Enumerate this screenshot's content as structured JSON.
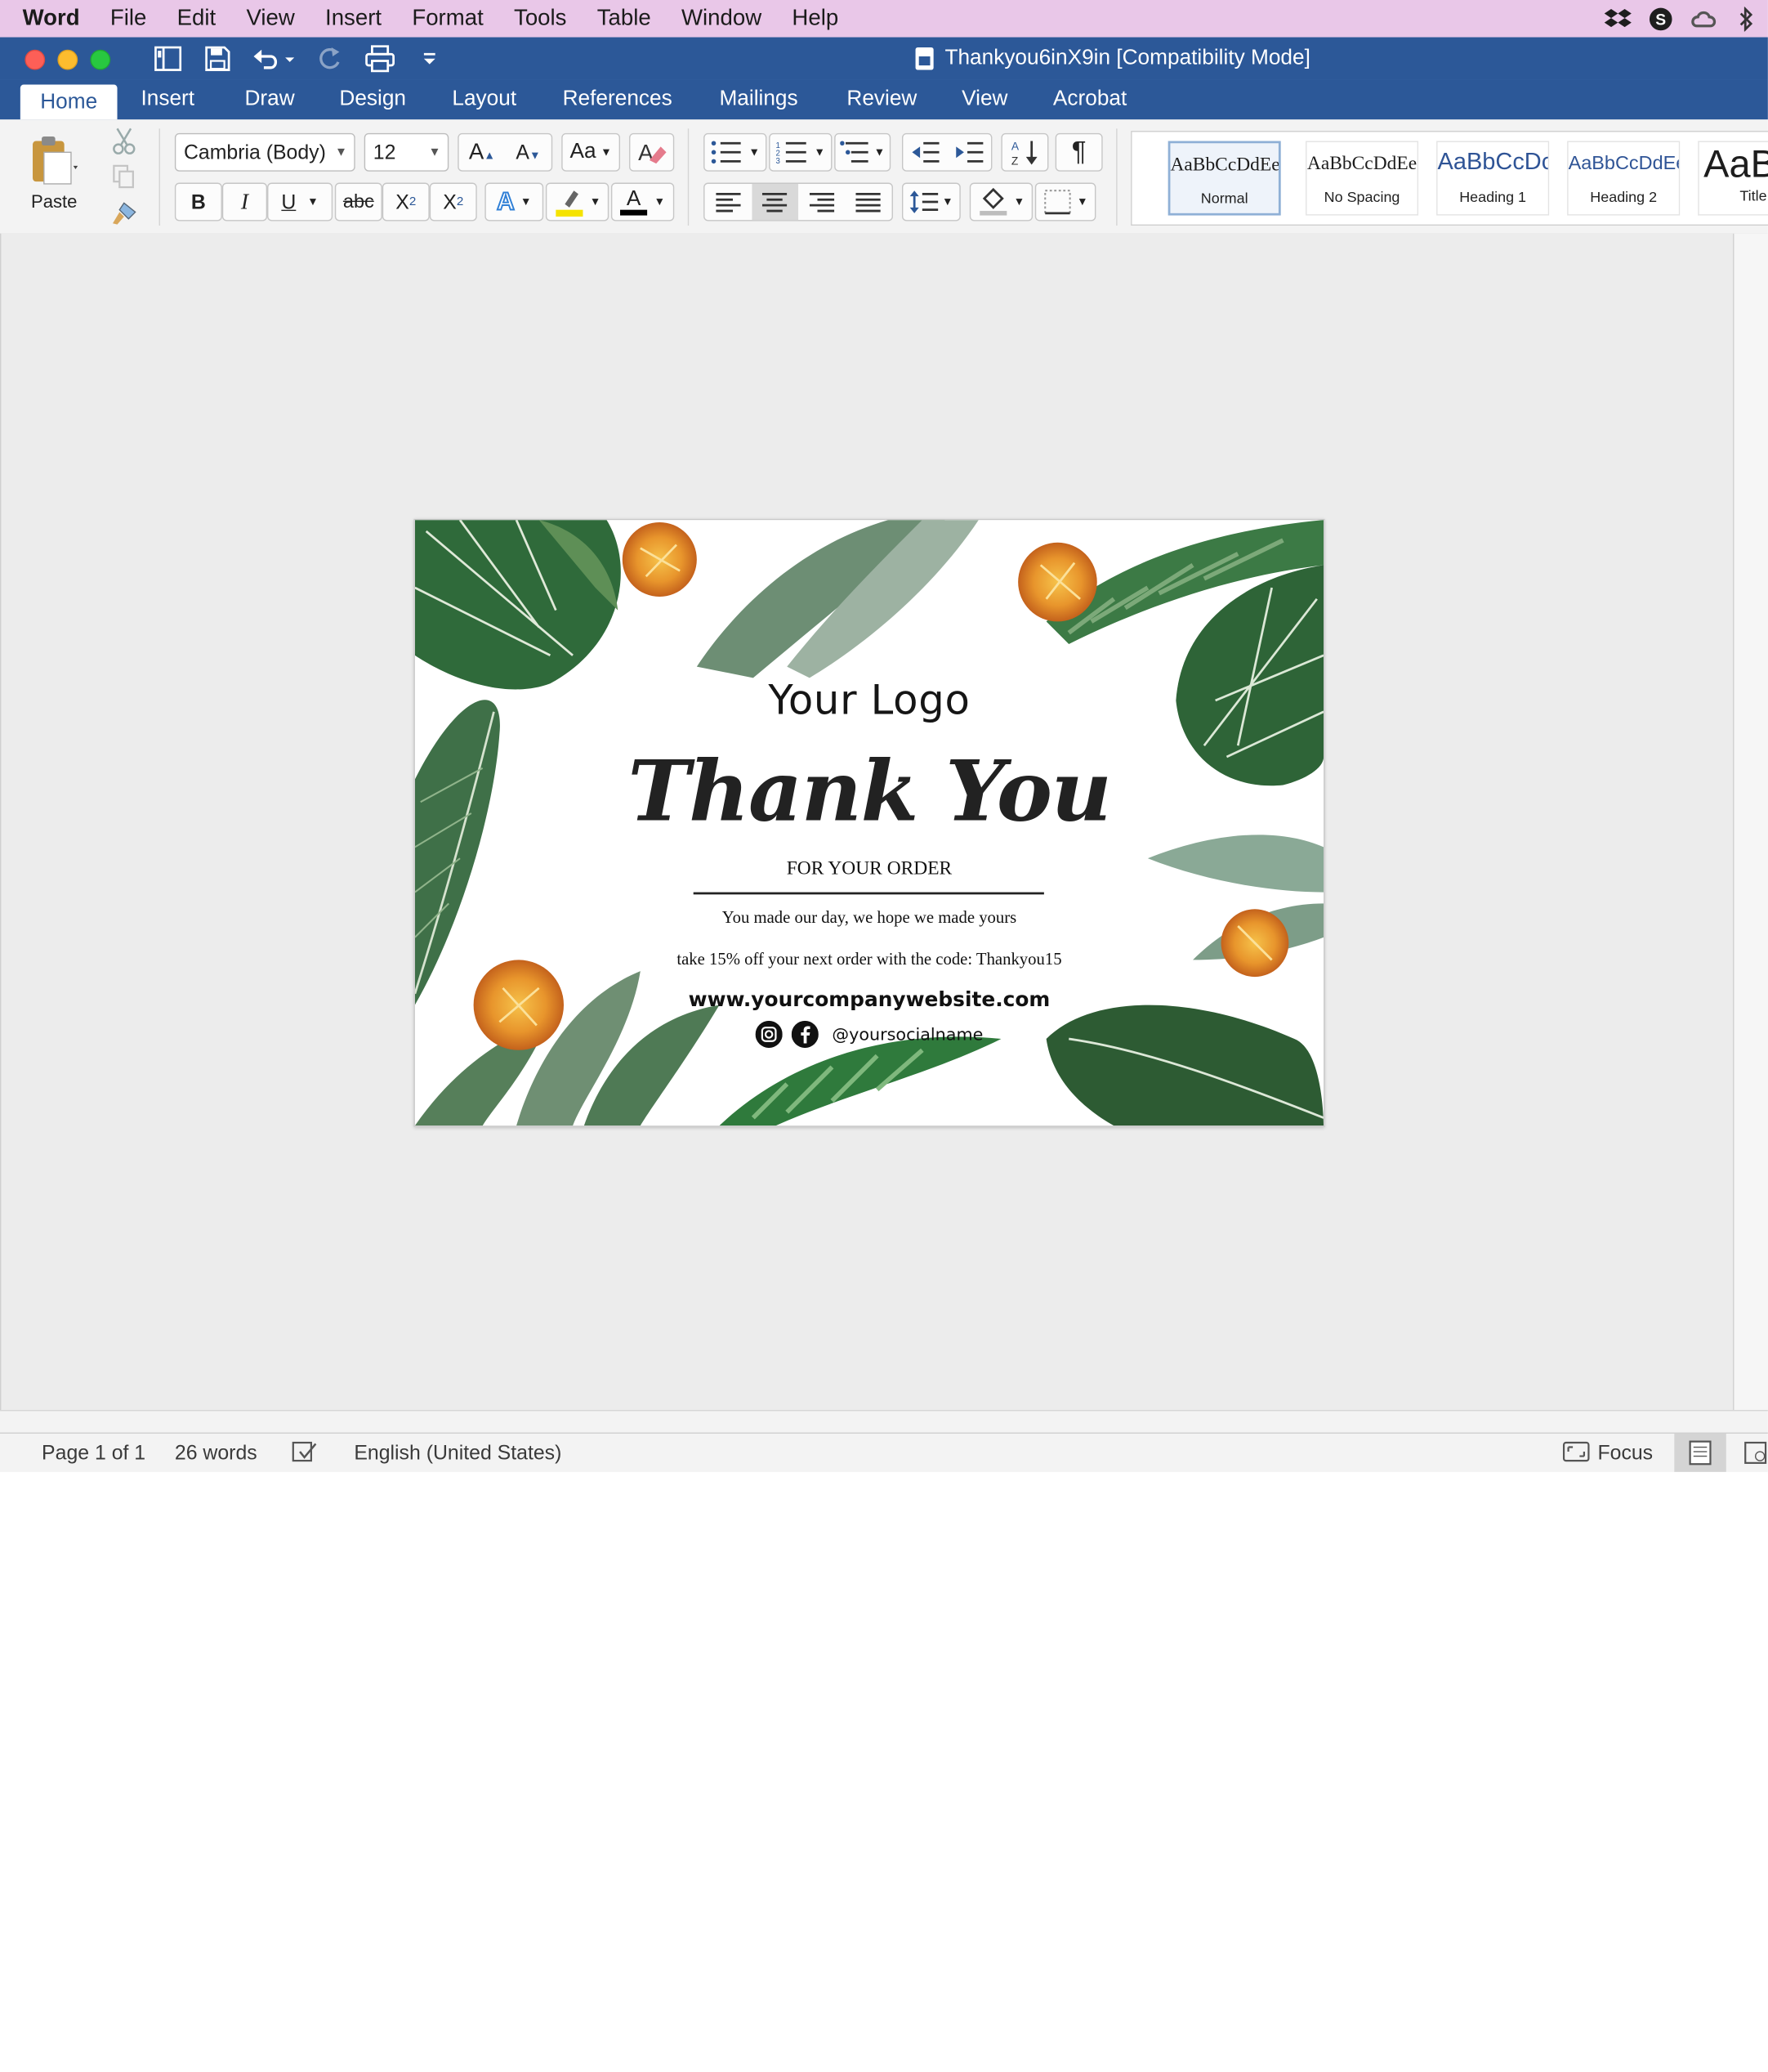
{
  "menubar": {
    "app": "Word",
    "items": [
      "File",
      "Edit",
      "View",
      "Insert",
      "Format",
      "Tools",
      "Table",
      "Window",
      "Help"
    ],
    "tray_icons": [
      "dropbox-icon",
      "skype-icon",
      "creative-cloud-icon",
      "bluetooth-icon"
    ]
  },
  "window": {
    "title": "Thankyou6inX9in [Compatibility Mode]"
  },
  "tabs": [
    "Home",
    "Insert",
    "Draw",
    "Design",
    "Layout",
    "References",
    "Mailings",
    "Review",
    "View",
    "Acrobat"
  ],
  "ribbon": {
    "paste_label": "Paste",
    "font_name": "Cambria (Body)",
    "font_size": "12",
    "grow_font": "A",
    "shrink_font": "A",
    "change_case": "Aa",
    "bold": "B",
    "italic": "I",
    "underline": "U",
    "strikethrough": "abc",
    "subscript": "X",
    "subscript_mark": "2",
    "superscript": "X",
    "superscript_mark": "2",
    "text_effects": "A",
    "font_color": "A",
    "pilcrow": "¶",
    "styles": [
      {
        "preview": "AaBbCcDdEe",
        "name": "Normal"
      },
      {
        "preview": "AaBbCcDdEe",
        "name": "No Spacing"
      },
      {
        "preview": "AaBbCcDc",
        "name": "Heading 1"
      },
      {
        "preview": "AaBbCcDdEe",
        "name": "Heading 2"
      },
      {
        "preview": "AaB",
        "name": "Title"
      }
    ]
  },
  "document": {
    "logo": "Your Logo",
    "headline": "Thank You",
    "subhead": "FOR YOUR ORDER",
    "line1": "You made our day, we hope we made yours",
    "line2": "take 15% off your next order with the code: Thankyou15",
    "website": "www.yourcompanywebsite.com",
    "social": "@yoursocialname"
  },
  "status": {
    "page": "Page 1 of 1",
    "words": "26 words",
    "language": "English (United States)",
    "focus": "Focus"
  },
  "colors": {
    "menubar": "#e9c7e8",
    "titlebar": "#2c5898",
    "workspace": "#ececec",
    "highlight_yellow": "#f5e300",
    "leaf_green": "#2f6a3a",
    "flower_orange": "#e8952c"
  }
}
